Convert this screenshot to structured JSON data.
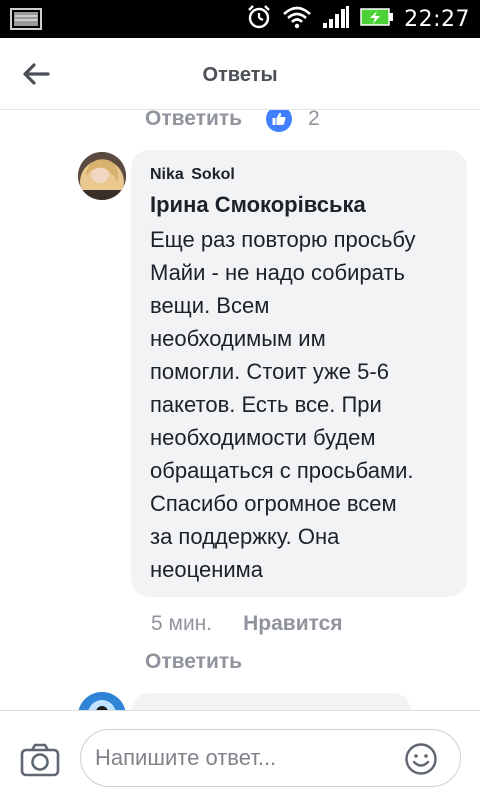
{
  "status_bar": {
    "time": "22:27",
    "icons": [
      "notification-icon",
      "alarm-icon",
      "wifi-icon",
      "signal-icon",
      "battery-charging-icon"
    ]
  },
  "header": {
    "title": "Ответы",
    "back_icon": "arrow-left-icon"
  },
  "previous_comment": {
    "reply_label": "Ответить",
    "like_icon": "thumbs-up-icon",
    "like_count": "2"
  },
  "comment": {
    "author": "Nika Sokol",
    "tagged_user": "Ірина Смокорівська",
    "text_lines": [
      "Еще раз повторю просьбу",
      "Майи - не надо собирать",
      "вещи. Всем",
      "необходимым им",
      "помогли. Стоит уже 5-6",
      "пакетов. Есть все. При",
      "необходимости будем",
      "обращаться с просьбами.",
      "Спасибо огромное всем",
      "за поддержку. Она",
      "неоценима"
    ],
    "time": "5 мин.",
    "like_label": "Нравится",
    "reply_label": "Ответить"
  },
  "composer": {
    "placeholder": "Напишите ответ...",
    "camera_icon": "camera-icon",
    "emoji_icon": "smiley-icon"
  },
  "colors": {
    "bubble": "#f2f3f5",
    "text": "#1d2129",
    "muted": "#90949c",
    "like_blue": "#4080ff",
    "header_title": "#4b4f56"
  }
}
